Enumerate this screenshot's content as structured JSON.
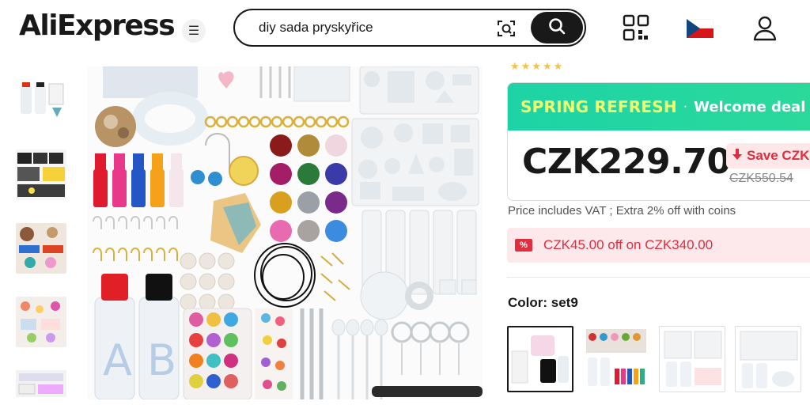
{
  "header": {
    "logo_text": "AliExpress",
    "search_value": "diy sada pryskyřice",
    "icons": [
      "menu-icon",
      "camera-search-icon",
      "search-icon",
      "qr-code-icon",
      "czech-flag-icon",
      "user-icon"
    ]
  },
  "product": {
    "deal_title": "SPRING REFRESH",
    "deal_separator": "·",
    "deal_subtitle": "Welcome deal",
    "price": "CZK229.70",
    "save_label": "Save CZK",
    "original_price": "CZK550.54",
    "vat_note": "Price includes VAT ; Extra 2% off with coins",
    "coupon_text": "CZK45.00 off on CZK340.00",
    "coupon_icon_glyph": "%",
    "color_label": "Color: set9"
  },
  "colors": {
    "accent_red": "#e02e3e",
    "deal_green": "#1dd3a6",
    "deal_yellow": "#f2ff6d",
    "star": "#f5c249"
  }
}
